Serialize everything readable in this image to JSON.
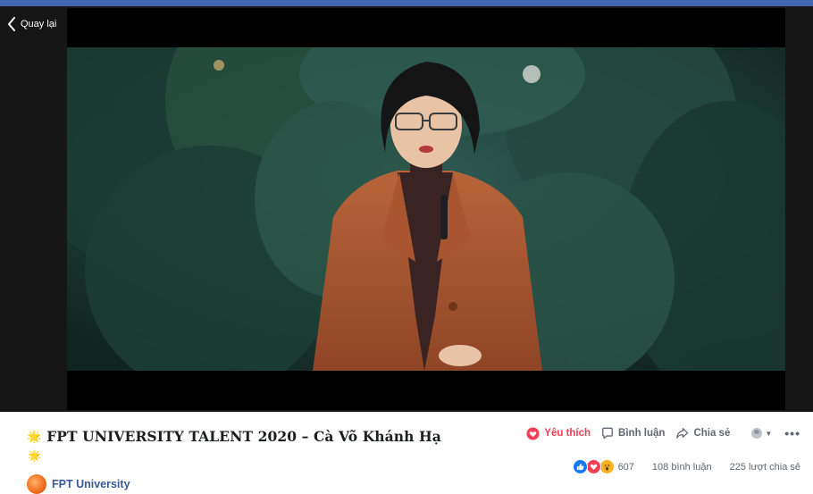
{
  "colors": {
    "brand_blue": "#4267b2",
    "love_red": "#f33e58",
    "link_blue": "#385898",
    "sparkle_gold": "#f5c400",
    "player_bg": "#161616"
  },
  "player": {
    "back_label": "Quay lại",
    "back_icon": "chevron-left-icon"
  },
  "post": {
    "title": "FPT UNIVERSITY TALENT 2020 – Cà Võ Khánh Hạ",
    "title_emoji": "🌟",
    "line2_emoji": "🌟",
    "page_name": "FPT University"
  },
  "actions": {
    "love_label": "Yêu thích",
    "comment_label": "Bình luận",
    "share_label": "Chia sẻ",
    "more_label": "•••"
  },
  "stats": {
    "reaction_count": "607",
    "comments": "108 bình luận",
    "shares": "225 lượt chia sẻ",
    "reaction_icons": [
      "like-icon",
      "love-icon",
      "wow-icon"
    ]
  }
}
